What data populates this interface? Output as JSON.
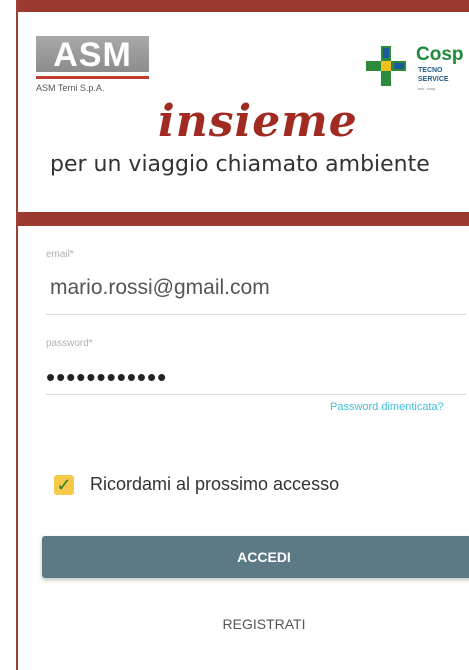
{
  "header": {
    "asm_logo": "ASM",
    "asm_subtitle": "ASM Terni S.p.A.",
    "title": "insieme",
    "tagline": "per un viaggio chiamato ambiente",
    "partner_logo": {
      "name": "Cosp",
      "line1": "TECNO",
      "line2": "SERVICE",
      "tiny": "soc. coop."
    }
  },
  "form": {
    "email_label": "email*",
    "email_value": "mario.rossi@gmail.com",
    "password_label": "password*",
    "password_value": "••••••••••••",
    "forgot_password": "Password dimenticata?",
    "remember_label": "Ricordami al prossimo accesso",
    "remember_checked": true,
    "login_button": "ACCEDI",
    "register_button": "REGISTRATI"
  },
  "colors": {
    "brand_red": "#9a3a30",
    "button": "#5b7a86",
    "link": "#3fbfd9",
    "checkbox": "#f7c94a"
  }
}
